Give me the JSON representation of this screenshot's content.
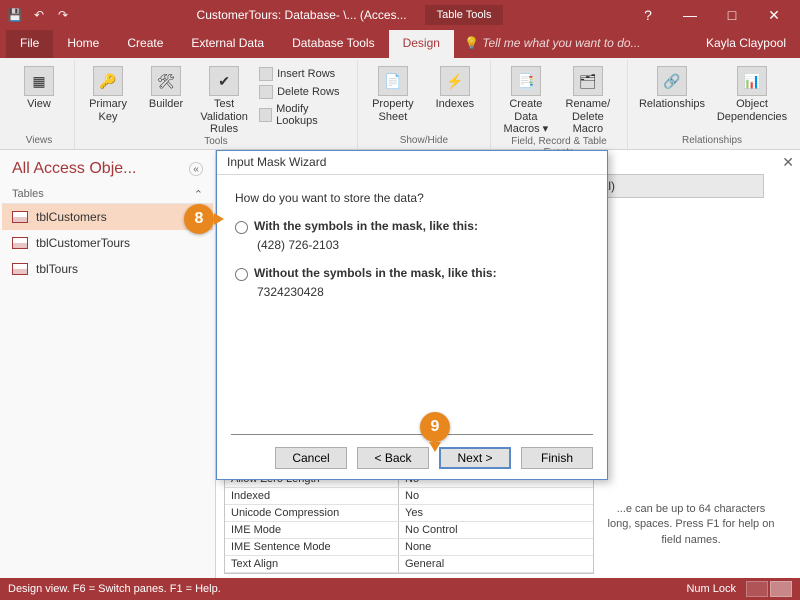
{
  "titlebar": {
    "doc_title": "CustomerTours: Database- \\... (Acces...",
    "context_tab": "Table Tools"
  },
  "win": {
    "help": "?",
    "min": "—",
    "max": "□",
    "close": "✕"
  },
  "tabs": {
    "file": "File",
    "home": "Home",
    "create": "Create",
    "external": "External Data",
    "dbtools": "Database Tools",
    "design": "Design",
    "tell_me": "Tell me what you want to do...",
    "user": "Kayla Claypool"
  },
  "ribbon": {
    "views": {
      "view": "View",
      "group": "Views"
    },
    "tools": {
      "primary_key": "Primary Key",
      "builder": "Builder",
      "test_validation": "Test Validation Rules",
      "insert_rows": "Insert Rows",
      "delete_rows": "Delete Rows",
      "modify_lookups": "Modify Lookups",
      "group": "Tools"
    },
    "showhide": {
      "property_sheet": "Property Sheet",
      "indexes": "Indexes",
      "group": "Show/Hide"
    },
    "events": {
      "create_macros": "Create Data Macros ▾",
      "rename_delete": "Rename/ Delete Macro",
      "group": "Field, Record & Table Events"
    },
    "relationships": {
      "relationships": "Relationships",
      "obj_dep": "Object Dependencies",
      "group": "Relationships"
    }
  },
  "nav": {
    "title": "All Access Obje...",
    "section": "Tables",
    "items": [
      {
        "label": "tblCustomers"
      },
      {
        "label": "tblCustomerTours"
      },
      {
        "label": "tblTours"
      }
    ]
  },
  "main": {
    "desc_header": "Description (Optional)",
    "close": "✕",
    "help_text": "...e can be up to 64 characters long, spaces. Press F1 for help on field names."
  },
  "field_props": [
    {
      "l": "Allow Zero Length",
      "r": "No"
    },
    {
      "l": "Indexed",
      "r": "No"
    },
    {
      "l": "Unicode Compression",
      "r": "Yes"
    },
    {
      "l": "IME Mode",
      "r": "No Control"
    },
    {
      "l": "IME Sentence Mode",
      "r": "None"
    },
    {
      "l": "Text Align",
      "r": "General"
    }
  ],
  "dialog": {
    "title": "Input Mask Wizard",
    "question": "How do you want to store the data?",
    "opt1": "With the symbols in the mask, like this:",
    "sample1": "(428) 726-2103",
    "opt2": "Without the symbols in the mask, like this:",
    "sample2": "7324230428",
    "cancel": "Cancel",
    "back": "< Back",
    "next": "Next >",
    "finish": "Finish"
  },
  "callouts": {
    "c8": "8",
    "c9": "9"
  },
  "status": {
    "left": "Design view.   F6 = Switch panes.   F1 = Help.",
    "numlock": "Num Lock"
  }
}
